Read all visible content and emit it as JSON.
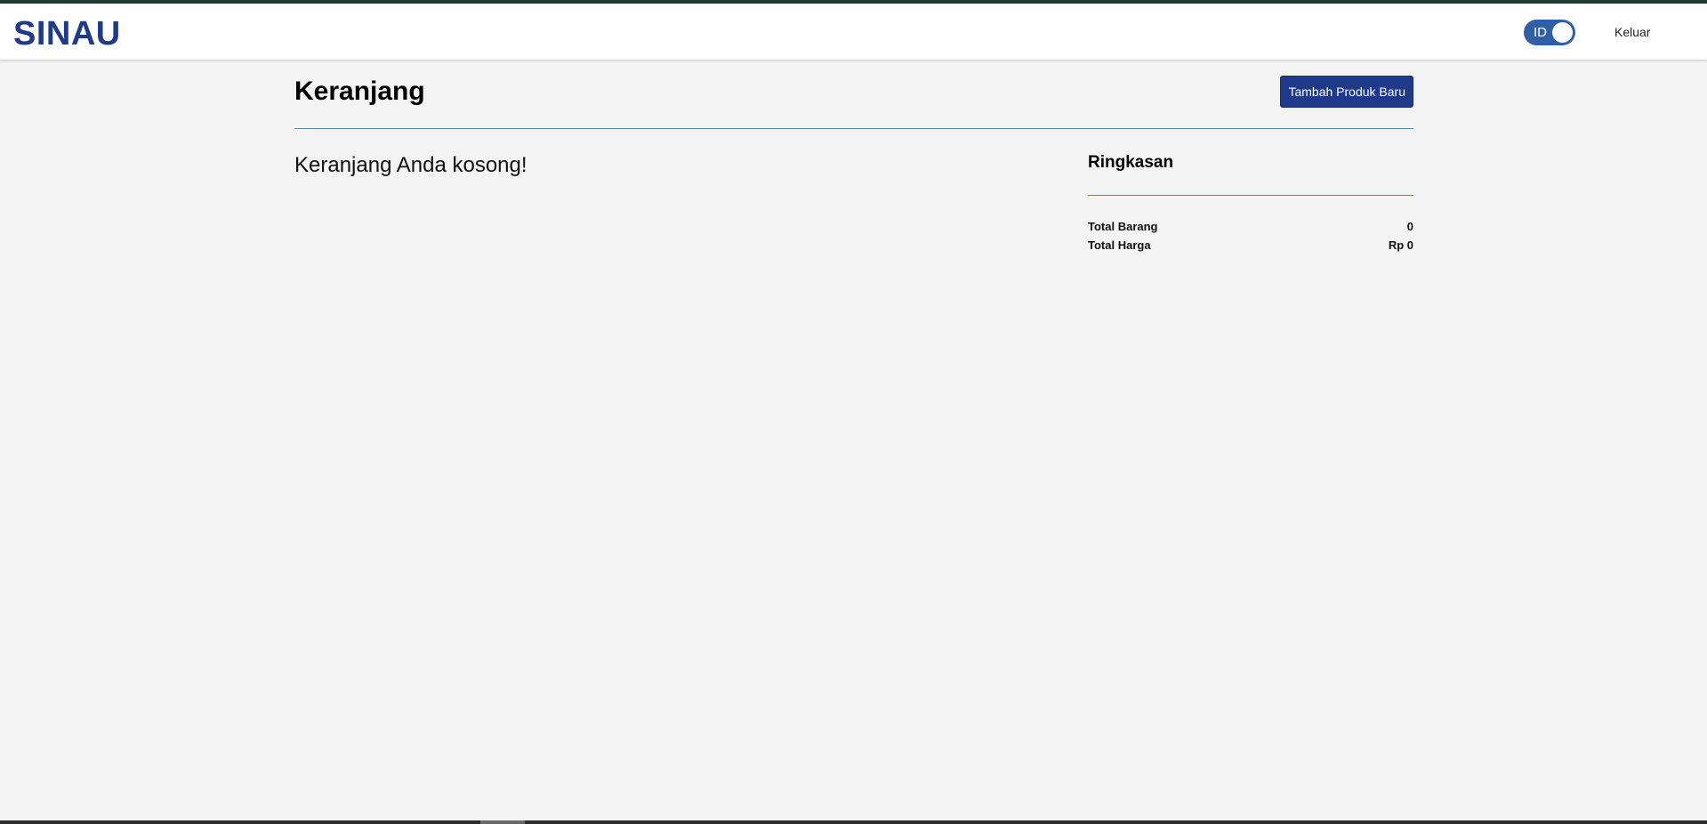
{
  "header": {
    "logo": "SINAU",
    "language_toggle": "ID",
    "logout_label": "Keluar"
  },
  "main": {
    "title": "Keranjang",
    "add_product_label": "Tambah Produk Baru",
    "empty_message": "Keranjang Anda kosong!"
  },
  "summary": {
    "title": "Ringkasan",
    "rows": [
      {
        "label": "Total Barang",
        "value": "0"
      },
      {
        "label": "Total Harga",
        "value": "Rp 0"
      }
    ]
  },
  "colors": {
    "brand": "#1f3a8a",
    "toggle": "#2f5fa5",
    "divider": "#5a84b8",
    "background": "#f3f3f3"
  }
}
